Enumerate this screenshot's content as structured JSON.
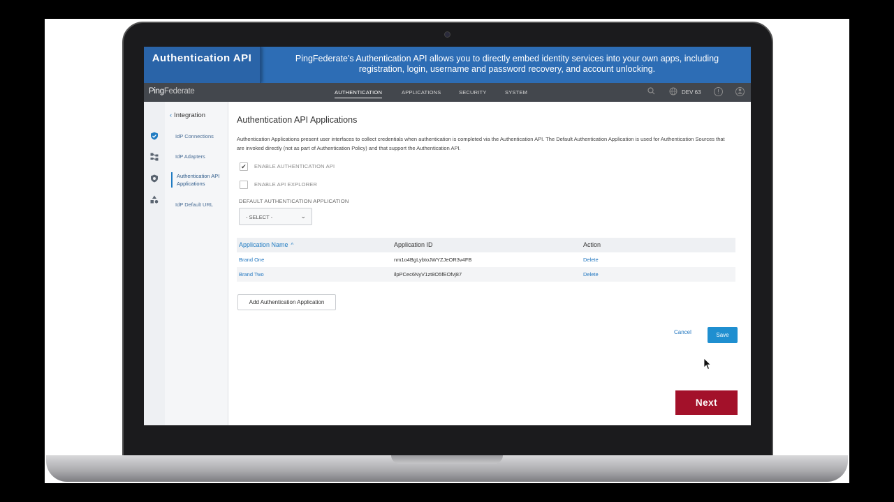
{
  "banner": {
    "title": "Authentication API",
    "text": "PingFederate's Authentication API allows you to directly embed identity services into your own apps, including registration, login, username and password recovery, and account unlocking."
  },
  "nav": {
    "logo_bold": "Ping",
    "logo_light": "Federate",
    "items": [
      {
        "label": "AUTHENTICATION",
        "active": true
      },
      {
        "label": "APPLICATIONS"
      },
      {
        "label": "SECURITY"
      },
      {
        "label": "SYSTEM"
      }
    ],
    "env": "DEV 63"
  },
  "icons": {
    "search": "search-icon",
    "globe": "globe-icon",
    "help": "help-icon",
    "user": "user-icon"
  },
  "subnav": {
    "back": "Integration",
    "items": [
      {
        "label": "IdP Connections"
      },
      {
        "label": "IdP Adapters"
      },
      {
        "label": "Authentication API Applications",
        "active": true
      },
      {
        "label": "IdP Default URL"
      }
    ]
  },
  "main": {
    "title": "Authentication API Applications",
    "description": "Authentication Applications present user interfaces to collect credentials when authentication is completed via the Authentication API. The Default Authentication Application is used for Authentication Sources that are invoked directly (not as part of Authentication Policy) and that support the Authentication API.",
    "enable_api": {
      "label": "ENABLE AUTHENTICATION API",
      "checked": true
    },
    "enable_explorer": {
      "label": "ENABLE API EXPLORER",
      "checked": false
    },
    "default_app_label": "DEFAULT AUTHENTICATION APPLICATION",
    "select_value": "- SELECT -",
    "table": {
      "headers": [
        "Application Name",
        "Application ID",
        "Action"
      ],
      "rows": [
        {
          "name": "Brand One",
          "id": "nm1o4BgLybtoJWYZJeOR3v4FB",
          "action": "Delete"
        },
        {
          "name": "Brand Two",
          "id": "ilpPCec6NyV1zt8O5fEOfvj87",
          "action": "Delete"
        }
      ]
    },
    "add_button": "Add Authentication Application",
    "cancel": "Cancel",
    "save": "Save"
  },
  "next": "Next",
  "colors": {
    "banner": "#2d6db5",
    "navbar": "#43474d",
    "accent": "#1f8fd0",
    "next": "#a3112a"
  }
}
